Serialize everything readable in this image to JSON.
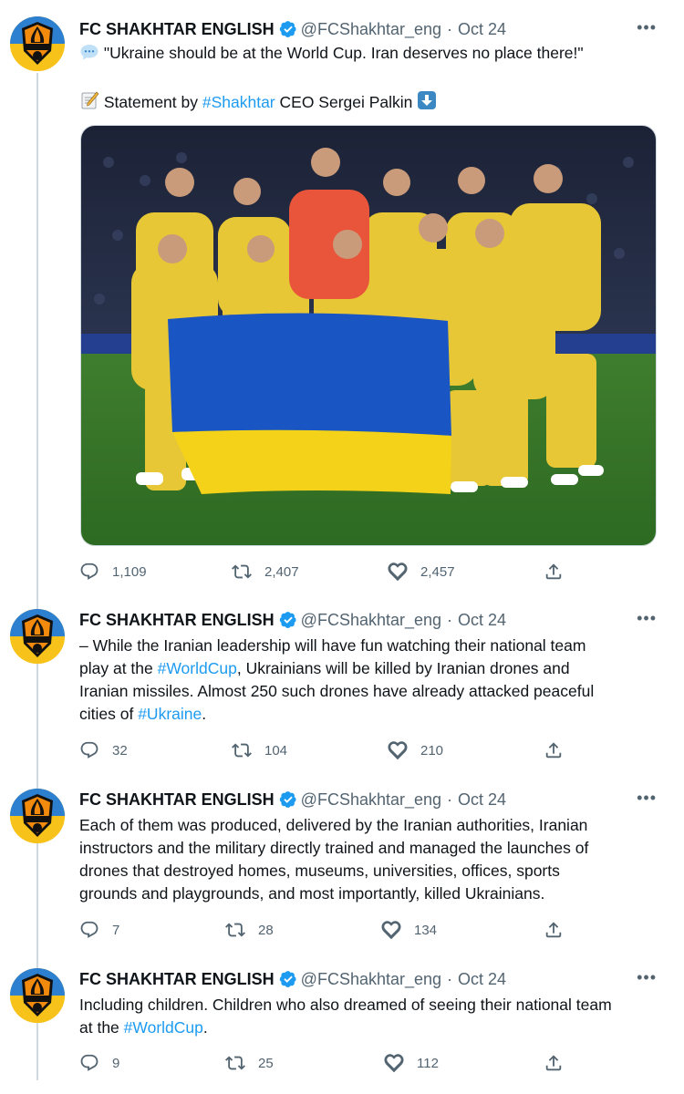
{
  "account": {
    "name": "FC SHAKHTAR ENGLISH",
    "handle": "@FCShakhtar_eng",
    "date": "Oct 24",
    "logo_text": "ШАХТАР",
    "logo_letter": "Д"
  },
  "colors": {
    "link": "#1d9bf0",
    "verified": "#1d9bf0",
    "muted": "#536471",
    "text": "#0f1419"
  },
  "more_label": "•••",
  "tweets": [
    {
      "lines": {
        "l1": "\"Ukraine should be at the World Cup. Iran deserves no place there!\"",
        "l2_pre": "Statement by ",
        "l2_tag": "#Shakhtar",
        "l2_post": " CEO Sergei Palkin "
      },
      "icons": [
        "speech-bubble-emoji",
        "memo-emoji",
        "down-arrow-emoji"
      ],
      "media": "Ukrainian national team photo holding the Ukrainian flag",
      "replies": "1,109",
      "retweets": "2,407",
      "likes": "2,457"
    },
    {
      "lines": {
        "l1": "– While the Iranian leadership will have fun watching their national team",
        "l2_pre": "play at the ",
        "l2_tag": "#WorldCup",
        "l2_post": ", Ukrainians will be killed by Iranian drones and",
        "l3": "Iranian missiles. Almost 250 such drones have already attacked peaceful",
        "l4_pre": "cities of ",
        "l4_tag": "#Ukraine",
        "l4_post": "."
      },
      "replies": "32",
      "retweets": "104",
      "likes": "210"
    },
    {
      "lines": {
        "l1": "Each of them was produced, delivered by the Iranian authorities, Iranian",
        "l2": "instructors and the military directly trained and managed the launches of",
        "l3": "drones that destroyed homes, museums, universities, offices, sports",
        "l4": "grounds and playgrounds, and most importantly, killed Ukrainians."
      },
      "replies": "7",
      "retweets": "28",
      "likes": "134"
    },
    {
      "lines": {
        "l1": "Including children. Children who also dreamed of seeing their national team",
        "l2_pre": "at the ",
        "l2_tag": "#WorldCup",
        "l2_post": "."
      },
      "replies": "9",
      "retweets": "25",
      "likes": "112"
    }
  ]
}
